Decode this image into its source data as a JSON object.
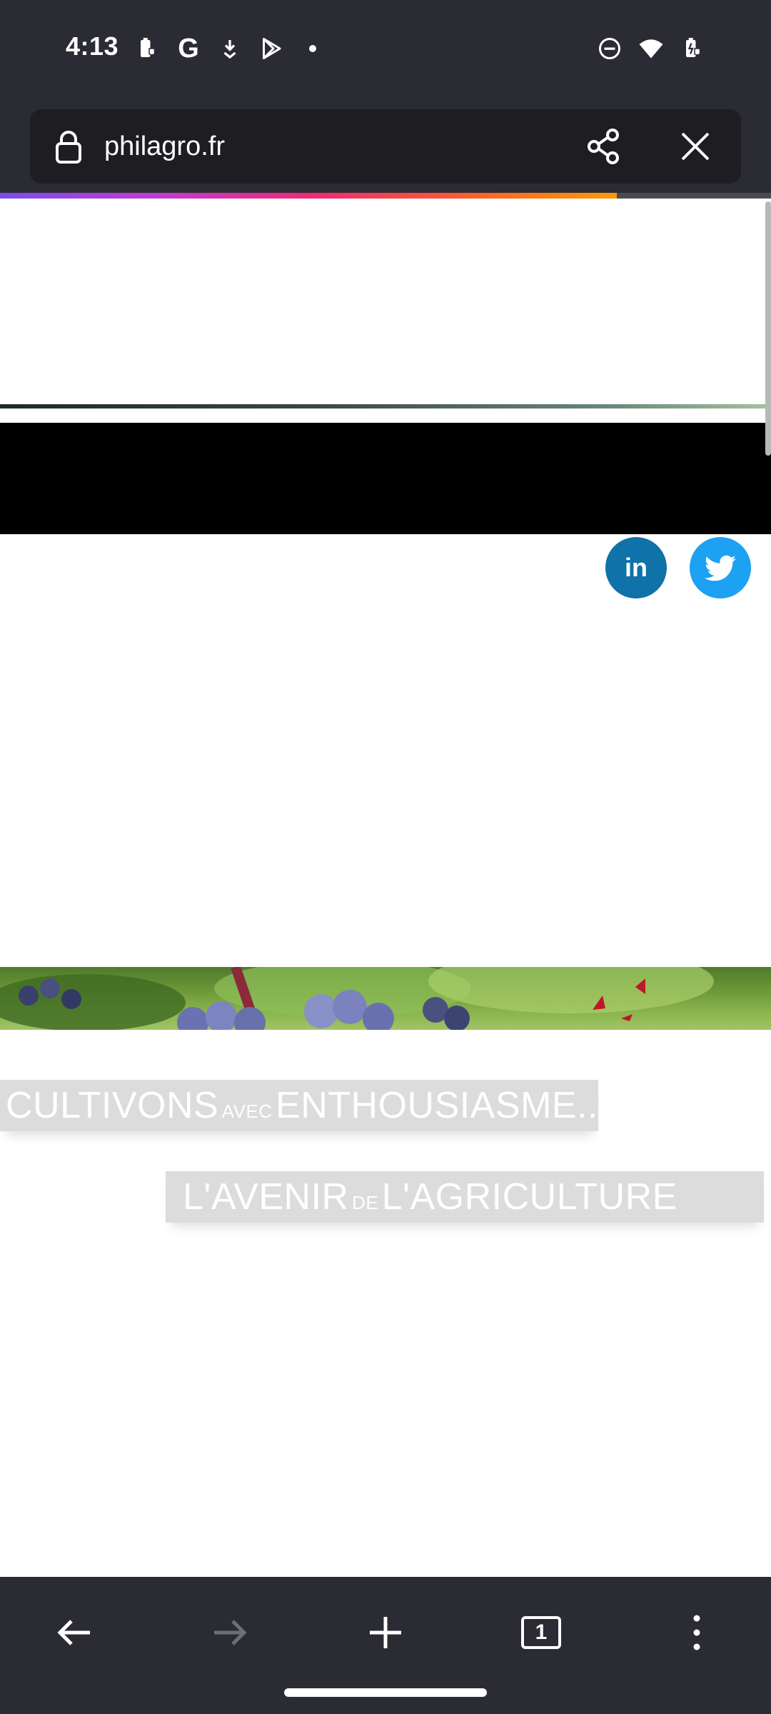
{
  "status_bar": {
    "time": "4:13",
    "left_icons": [
      "battery-saver-icon",
      "google-icon",
      "download-icon",
      "play-store-icon",
      "notification-dot-icon"
    ],
    "google_letter": "G",
    "right_icons": [
      "do-not-disturb-icon",
      "wifi-icon",
      "battery-charging-icon"
    ]
  },
  "browser": {
    "url": "philagro.fr",
    "load_progress": 0.8,
    "progress_colors": [
      "#7a4cf0",
      "#c13ad3",
      "#f2277a",
      "#ff5a2a",
      "#ff9a00"
    ]
  },
  "page": {
    "social": {
      "linkedin_label": "in",
      "linkedin_color": "#0f72a8",
      "twitter_color": "#1da1f2"
    },
    "slogan": {
      "line1_part1": "CULTIVONS",
      "line1_small": "AVEC",
      "line1_part2": "ENTHOUSIASME...",
      "line2_part1": "L'AVENIR",
      "line2_small": "DE",
      "line2_part2": "L'AGRICULTURE"
    }
  },
  "bottom_nav": {
    "tab_count": "1",
    "items": [
      "back-icon",
      "forward-icon",
      "new-tab-icon",
      "tabs-icon",
      "menu-icon"
    ]
  },
  "colors": {
    "chrome_bg": "#2b2b33",
    "urlbar_bg": "#1d1d22"
  }
}
